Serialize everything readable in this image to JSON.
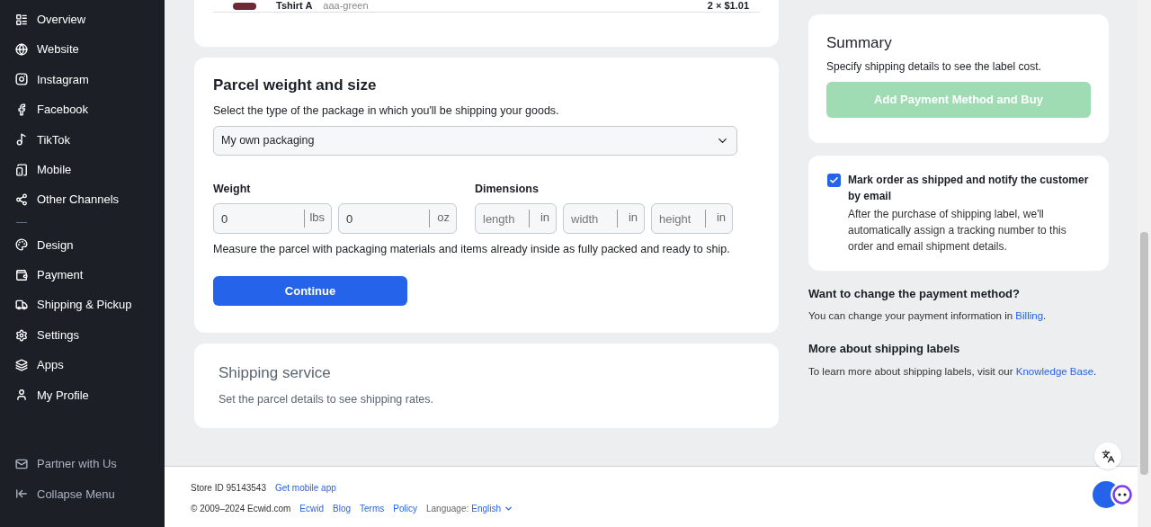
{
  "sidebar": {
    "items": [
      {
        "kind": "overview",
        "label": "Overview"
      },
      {
        "kind": "website",
        "label": "Website"
      },
      {
        "kind": "instagram",
        "label": "Instagram"
      },
      {
        "kind": "facebook",
        "label": "Facebook"
      },
      {
        "kind": "tiktok",
        "label": "TikTok"
      },
      {
        "kind": "mobile",
        "label": "Mobile"
      },
      {
        "kind": "channels",
        "label": "Other Channels"
      },
      {
        "kind": "divider"
      },
      {
        "kind": "design",
        "label": "Design"
      },
      {
        "kind": "payment",
        "label": "Payment"
      },
      {
        "kind": "shipping",
        "label": "Shipping & Pickup"
      },
      {
        "kind": "settings",
        "label": "Settings"
      },
      {
        "kind": "apps",
        "label": "Apps"
      },
      {
        "kind": "profile",
        "label": "My Profile"
      }
    ],
    "bottom_items": [
      {
        "kind": "mail",
        "label": "Partner with Us"
      },
      {
        "kind": "collapse",
        "label": "Collapse Menu"
      }
    ]
  },
  "order_item": {
    "name": "Tshirt A",
    "variant": "aaa-green",
    "price": "2 × $1.01"
  },
  "parcel": {
    "title": "Parcel weight and size",
    "subtitle": "Select the type of the package in which you'll be shipping your goods.",
    "package_select": {
      "value": "My own packaging"
    },
    "weight": {
      "label": "Weight",
      "fields": [
        {
          "value": "0",
          "unit": "lbs"
        },
        {
          "value": "0",
          "unit": "oz"
        }
      ]
    },
    "dimensions": {
      "label": "Dimensions",
      "fields": [
        {
          "placeholder": "length",
          "unit": "in"
        },
        {
          "placeholder": "width",
          "unit": "in"
        },
        {
          "placeholder": "height",
          "unit": "in"
        }
      ]
    },
    "hint": "Measure the parcel with packaging materials and items already inside as fully packed and ready to ship.",
    "button": "Continue"
  },
  "shipping_service": {
    "title": "Shipping service",
    "subtitle": "Set the parcel details to see shipping rates."
  },
  "summary": {
    "title": "Summary",
    "subtitle": "Specify shipping details to see the label cost.",
    "button": {
      "label": "Add Payment Method and Buy",
      "disabled": true
    }
  },
  "notify": {
    "checked": true,
    "label": "Mark order as shipped and notify the customer by email",
    "description": "After the purchase of shipping label, we'll automatically assign a tracking number to this order and email shipment details."
  },
  "payment_change": {
    "title": "Want to change the payment method?",
    "text": "You can change your payment information in ",
    "link": "Billing",
    "after": "."
  },
  "labels_info": {
    "title": "More about shipping labels",
    "text": "To learn more about shipping labels, visit our ",
    "link": "Knowledge Base",
    "after": "."
  },
  "footer": {
    "store_id": "Store ID 95143543",
    "mobile_link": "Get mobile app",
    "copyright": "© 2009–2024 Ecwid.com",
    "links": [
      "Ecwid",
      "Blog",
      "Terms",
      "Policy"
    ],
    "language_label": "Language:",
    "language": "English"
  }
}
